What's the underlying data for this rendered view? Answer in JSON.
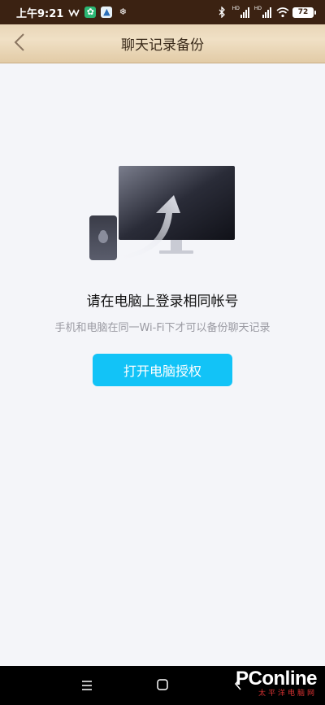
{
  "status_bar": {
    "time": "上午9:21",
    "battery": "72",
    "signal1": "HD",
    "signal2": "HD"
  },
  "nav": {
    "title": "聊天记录备份",
    "back_icon": "chevron-left-icon"
  },
  "main": {
    "headline": "请在电脑上登录相同帐号",
    "subtext": "手机和电脑在同一Wi-Fi下才可以备份聊天记录",
    "button_label": "打开电脑授权"
  },
  "bottom_nav": {
    "menu_icon": "menu-icon",
    "home_icon": "home-icon",
    "back_icon": "back-icon"
  },
  "watermark": {
    "brand": "PConline",
    "sub": "太平洋电脑网"
  },
  "colors": {
    "accent": "#12c3f7",
    "status_bar": "#3b2212",
    "nav_bar": "#e9d6b8",
    "background": "#f4f5f9"
  }
}
